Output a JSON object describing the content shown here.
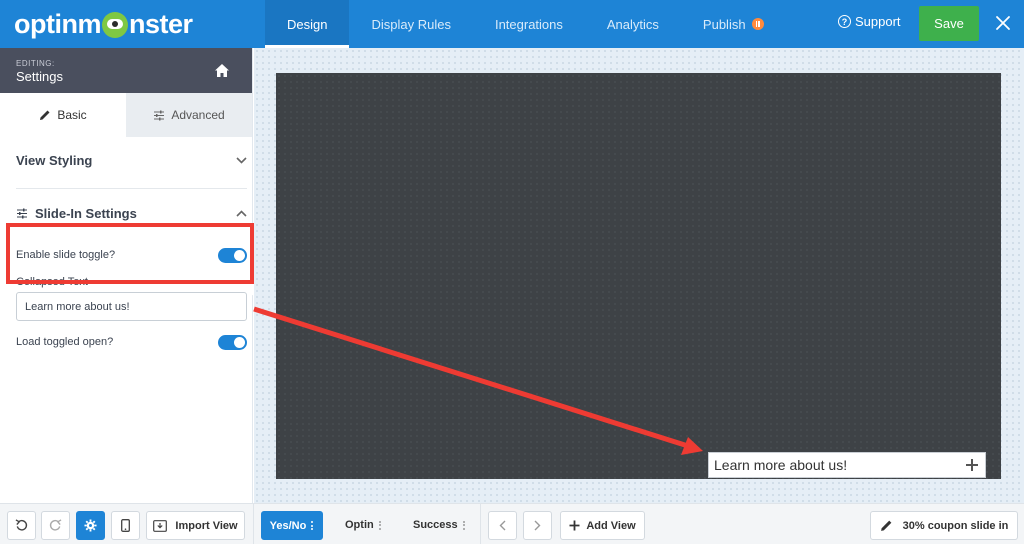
{
  "header": {
    "logo_text_left": "optinm",
    "logo_text_right": "nster",
    "nav": [
      {
        "label": "Design"
      },
      {
        "label": "Display Rules"
      },
      {
        "label": "Integrations"
      },
      {
        "label": "Analytics"
      },
      {
        "label": "Publish"
      }
    ],
    "support_label": "Support",
    "save_label": "Save"
  },
  "sidebar": {
    "editing_label": "EDITING:",
    "editing_title": "Settings",
    "tabs": [
      {
        "label": "Basic",
        "active": true
      },
      {
        "label": "Advanced",
        "active": false
      }
    ],
    "view_styling_label": "View Styling",
    "slidein_settings_label": "Slide-In Settings",
    "enable_toggle_label": "Enable slide toggle?",
    "enable_toggle_on": true,
    "collapsed_text_label": "Collapsed Text",
    "collapsed_text_value": "Learn more about us!",
    "load_open_label": "Load toggled open?",
    "load_open_on": true
  },
  "canvas": {
    "slide_tab_text": "Learn more about us!"
  },
  "bottombar": {
    "import_view_label": "Import View",
    "views": [
      {
        "label": "Yes/No",
        "active": true
      },
      {
        "label": "Optin",
        "active": false
      },
      {
        "label": "Success",
        "active": false
      }
    ],
    "add_view_label": "Add View",
    "campaign_name": "30% coupon slide in"
  },
  "colors": {
    "brand_blue": "#1e84d6",
    "save_green": "#3eb04c",
    "highlight_red": "#ee3b33"
  }
}
